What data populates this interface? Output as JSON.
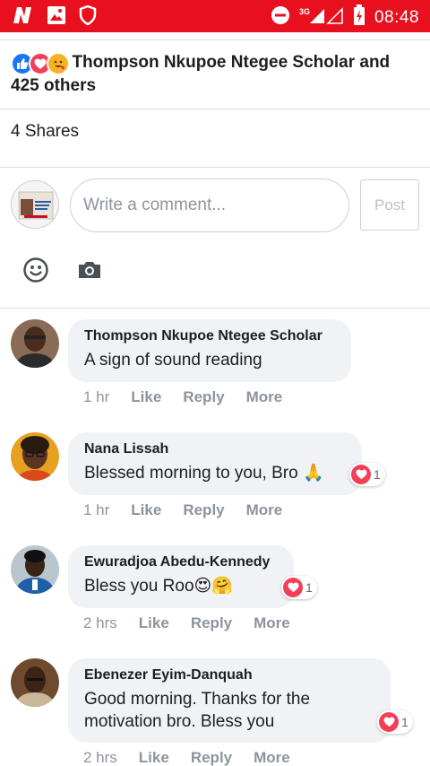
{
  "status_bar": {
    "time": "08:48",
    "network": "3G",
    "icons": [
      "app-n-icon",
      "gallery-icon",
      "shield-icon",
      "do-not-disturb-icon",
      "signal-icon",
      "battery-charging-icon"
    ]
  },
  "post": {
    "reaction_icons": [
      "like-reaction-icon",
      "love-reaction-icon",
      "wow-reaction-icon"
    ],
    "reactions_summary": "Thompson Nkupoe Ntegee Scholar and 425 others",
    "shares": "4 Shares"
  },
  "composer": {
    "placeholder": "Write a comment...",
    "post_label": "Post",
    "tools": [
      "emoji-icon",
      "camera-icon"
    ]
  },
  "comments": [
    {
      "author": "Thompson Nkupoe Ntegee Scholar",
      "text": "A sign of sound reading",
      "time": "1 hr",
      "like": "Like",
      "reply": "Reply",
      "more": "More"
    },
    {
      "author": "Nana Lissah",
      "text": "Blessed morning to you, Bro 🙏",
      "time": "1 hr",
      "like": "Like",
      "reply": "Reply",
      "more": "More",
      "reaction_count": "1"
    },
    {
      "author": "Ewuradjoa Abedu-Kennedy",
      "text": "Bless you Roo😍🤗",
      "time": "2 hrs",
      "like": "Like",
      "reply": "Reply",
      "more": "More",
      "reaction_count": "1"
    },
    {
      "author": "Ebenezer Eyim-Danquah",
      "text": "Good morning. Thanks for the motivation bro. Bless you",
      "time": "2 hrs",
      "like": "Like",
      "reply": "Reply",
      "more": "More",
      "reaction_count": "1"
    }
  ],
  "colors": {
    "status_bar": "#e8101e",
    "bubble": "#f0f2f5",
    "meta_text": "#8d949e",
    "love": "#f33e58",
    "like": "#1877f2"
  }
}
